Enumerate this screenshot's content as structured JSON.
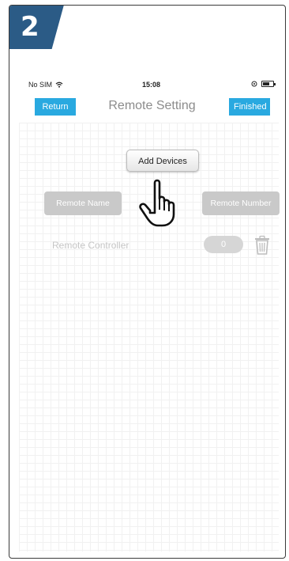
{
  "step": {
    "number": "2"
  },
  "status_bar": {
    "carrier": "No SIM",
    "time": "15:08",
    "wifi_icon": "wifi-icon",
    "battery_icon": "battery-icon"
  },
  "navbar": {
    "return_label": "Return",
    "title": "Remote Setting",
    "finished_label": "Finished"
  },
  "content": {
    "add_devices_label": "Add Devices",
    "remote_name_label": "Remote Name",
    "remote_number_label": "Remote Number",
    "row": {
      "label": "Remote Controller",
      "count": "0",
      "delete_icon": "trash-icon"
    }
  },
  "overlay": {
    "pointer_icon": "hand-pointer-icon"
  },
  "colors": {
    "accent": "#29a9e0",
    "badge": "#2b5b86",
    "disabled": "#c9c9c9"
  }
}
